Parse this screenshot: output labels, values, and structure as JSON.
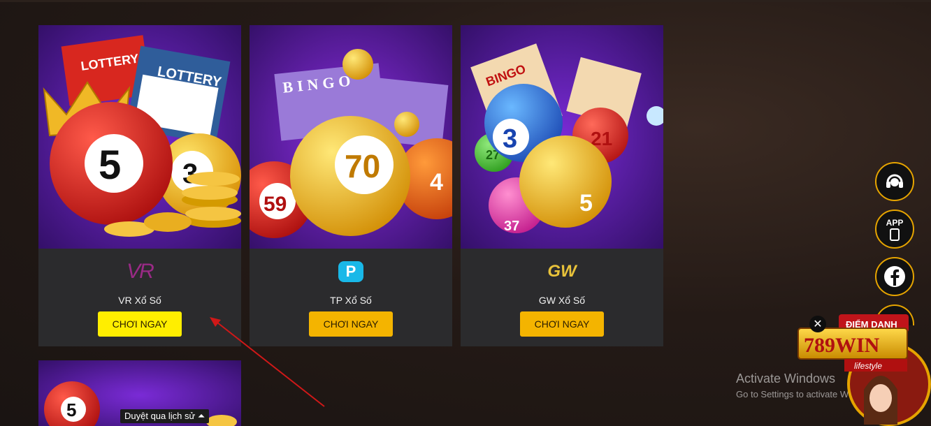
{
  "games": [
    {
      "name": "VR Xổ Số",
      "button": "CHƠI NGAY",
      "logo_text": "VR",
      "ball": "5",
      "ball2": "3",
      "ticket1": "LOTTERY",
      "ticket2": "LOTTERY"
    },
    {
      "name": "TP Xổ Số",
      "button": "CHƠI NGAY",
      "logo_text": "P",
      "ball": "70",
      "ball_left": "59",
      "ball_right": "4",
      "ticket": "BINGO"
    },
    {
      "name": "GW Xổ Số",
      "button": "CHƠI NGAY",
      "logo_text": "GW",
      "ball": "3",
      "ball2": "27",
      "ball3": "21",
      "ball4": "5",
      "ball5": "37",
      "ticket": "BINGO"
    }
  ],
  "preview_ball": "5",
  "history_label": "Duyệt qua lịch sử",
  "side_buttons": [
    "headset-icon",
    "app-icon",
    "facebook-icon"
  ],
  "app_label": "APP",
  "promo": {
    "brand": "789WIN",
    "tagline": "lifestyle",
    "banner": "ĐIỂM DANH"
  },
  "activate": {
    "title": "Activate Windows",
    "subtitle": "Go to Settings to activate Windows."
  },
  "colors": {
    "vr_button": "#ffee00",
    "play_button": "#f4b400",
    "accent_ring": "#e6a400",
    "card_bg": "#2b2b2d",
    "arrow": "#d01818"
  }
}
